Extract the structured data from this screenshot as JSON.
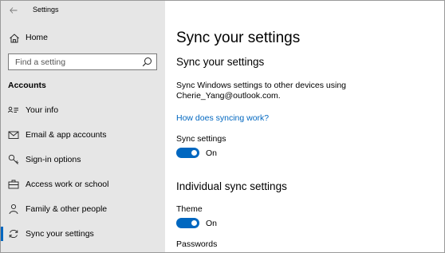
{
  "window": {
    "title": "Settings"
  },
  "sidebar": {
    "home_label": "Home",
    "search_placeholder": "Find a setting",
    "section_heading": "Accounts",
    "items": [
      {
        "label": "Your info",
        "icon": "person-card-icon"
      },
      {
        "label": "Email & app accounts",
        "icon": "mail-icon"
      },
      {
        "label": "Sign-in options",
        "icon": "key-icon"
      },
      {
        "label": "Access work or school",
        "icon": "briefcase-icon"
      },
      {
        "label": "Family & other people",
        "icon": "person-icon"
      },
      {
        "label": "Sync your settings",
        "icon": "sync-icon",
        "selected": true
      }
    ]
  },
  "main": {
    "page_title": "Sync your settings",
    "sync_heading": "Sync your settings",
    "description_line1": "Sync Windows settings to other devices using",
    "description_line2": "Cherie_Yang@outlook.com.",
    "help_link": "How does syncing work?",
    "sync_settings_label": "Sync settings",
    "sync_settings_state": "On",
    "individual_heading": "Individual sync settings",
    "theme_label": "Theme",
    "theme_state": "On",
    "passwords_label": "Passwords"
  },
  "colors": {
    "accent": "#0067c0",
    "sidebar_bg": "#e6e6e6"
  }
}
